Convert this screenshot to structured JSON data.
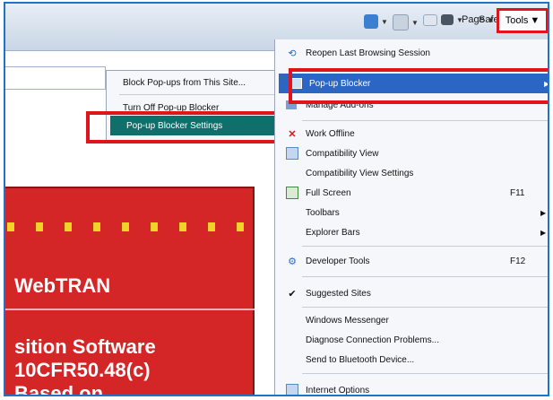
{
  "toolbar": {
    "items": [
      {
        "name": "home-icon",
        "label": ""
      },
      {
        "name": "feeds-icon",
        "label": ""
      },
      {
        "name": "mail-icon",
        "label": ""
      },
      {
        "name": "print-icon",
        "label": ""
      }
    ],
    "page_label": "Page",
    "safety_label": "Safety",
    "tools_label": "Tools"
  },
  "popup_submenu": {
    "items": [
      {
        "label": "Block Pop-ups from This Site..."
      },
      {
        "label": "Turn Off Pop-up Blocker"
      },
      {
        "label": "Pop-up Blocker Settings",
        "highlighted": true
      }
    ]
  },
  "tools_menu": {
    "items": [
      {
        "label": "Reopen Last Browsing Session",
        "icon": "reopen-icon"
      },
      {
        "label": "Pop-up Blocker",
        "icon": "popup-icon",
        "submenu": true,
        "highlighted": true
      },
      {
        "label": "Manage Add-ons",
        "icon": "addons-icon"
      },
      {
        "label": "Work Offline",
        "icon": "offline-icon"
      },
      {
        "label": "Compatibility View",
        "icon": "compat-icon"
      },
      {
        "label": "Compatibility View Settings"
      },
      {
        "label": "Full Screen",
        "icon": "fullscreen-icon",
        "shortcut": "F11"
      },
      {
        "label": "Toolbars",
        "submenu": true
      },
      {
        "label": "Explorer Bars",
        "submenu": true
      },
      {
        "label": "Developer Tools",
        "icon": "devtools-icon",
        "shortcut": "F12"
      },
      {
        "label": "Suggested Sites",
        "icon": "check-icon"
      },
      {
        "label": "Windows Messenger"
      },
      {
        "label": "Diagnose Connection Problems..."
      },
      {
        "label": "Send to Bluetooth Device..."
      },
      {
        "label": "Internet Options",
        "icon": "options-icon"
      }
    ]
  },
  "page": {
    "lines": [
      "WebTRAN",
      "sition Software",
      "10CFR50.48(c)",
      "Based on"
    ]
  },
  "colors": {
    "highlight_red": "#e0151b",
    "selection": "#0f6f6a",
    "banner_red": "#d42626"
  }
}
